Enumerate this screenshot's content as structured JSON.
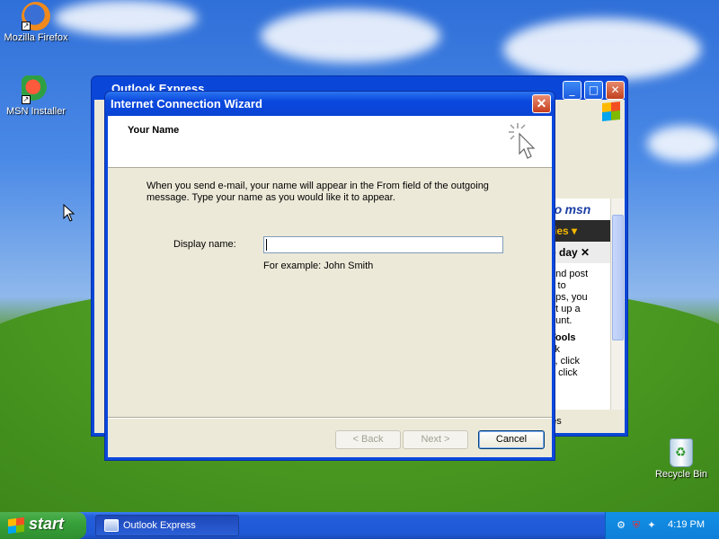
{
  "desktop": {
    "icons": [
      {
        "label": "Mozilla Firefox"
      },
      {
        "label": "MSN Installer"
      },
      {
        "label": "Recycle Bin"
      }
    ]
  },
  "outlook": {
    "title": "Outlook Express",
    "msn_brand": "msn",
    "msn_to": "to",
    "msn_bar": "ties ▾",
    "msn_tip": "e day ✕",
    "msn_text1": "and post\ns to\nups, you\net up a\nount.",
    "msn_text2": "Tools",
    "msn_text3": "ck\ns, click\nn click",
    "status_fragment": "ges"
  },
  "wizard": {
    "title": "Internet Connection Wizard",
    "heading": "Your Name",
    "description": "When you send e-mail, your name will appear in the From field of the outgoing message. Type your name as you would like it to appear.",
    "display_name_label": "Display name:",
    "display_name_value": "",
    "example": "For example: John Smith",
    "back_label": "< Back",
    "next_label": "Next >",
    "cancel_label": "Cancel"
  },
  "taskbar": {
    "start_label": "start",
    "task_label": "Outlook Express",
    "clock": "4:19 PM"
  },
  "colors": {
    "titlebar": "#0a48de",
    "dialog_face": "#ece9d8",
    "start_green": "#38a13a"
  }
}
